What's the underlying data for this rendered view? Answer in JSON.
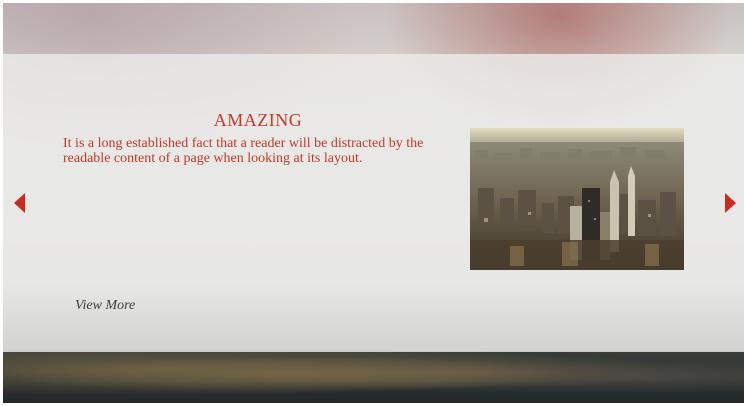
{
  "slide": {
    "title": "AMAZING",
    "body": "It is a long established fact that a reader will be distracted by the readable content of a page when looking at its layout.",
    "view_more_label": "View More",
    "image_alt": "City skyline aerial view"
  },
  "icons": {
    "prev": "triangle-left-arrow",
    "next": "triangle-right-arrow"
  },
  "colors": {
    "accent": "#c0392b",
    "arrow": "#cc2a1f",
    "link": "#3c3c3c"
  }
}
